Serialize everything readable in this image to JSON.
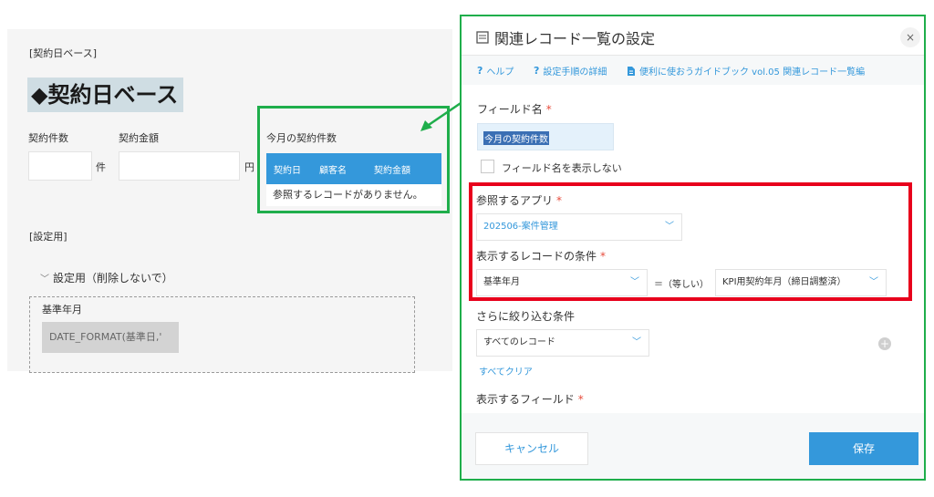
{
  "form": {
    "section_top_label": "[契約日ベース]",
    "title": "◆契約日ベース",
    "contract_count_label": "契約件数",
    "contract_amount_label": "契約金額",
    "unit_count": "件",
    "unit_yen": "円",
    "ref_table": {
      "label": "今月の契約件数",
      "columns": [
        "契約日",
        "顧客名",
        "契約金額"
      ],
      "empty_message": "参照するレコードがありません。"
    },
    "settings_section_label": "[設定用]",
    "settings_group_label": "設定用（削除しないで）",
    "base_month_label": "基準年月",
    "base_month_formula": "DATE_FORMAT(基準日,'"
  },
  "dialog": {
    "title": "関連レコード一覧の設定",
    "close": "×",
    "help_links": {
      "help": "ヘルプ",
      "steps": "設定手順の詳細",
      "guidebook": "便利に使おうガイドブック vol.05 関連レコード一覧編"
    },
    "field_name_label": "フィールド名",
    "field_name_value": "今月の契約件数",
    "hide_field_name_label": "フィールド名を表示しない",
    "ref_app_label": "参照するアプリ",
    "ref_app_value": "202506-案件管理",
    "condition_label": "表示するレコードの条件",
    "condition_left": "基準年月",
    "condition_operator": "＝（等しい）",
    "condition_right": "KPI用契約年月（締日調整済）",
    "filter_label": "さらに絞り込む条件",
    "filter_value": "すべてのレコード",
    "clear_all": "すべてクリア",
    "display_fields_label": "表示するフィールド",
    "cancel_label": "キャンセル",
    "save_label": "保存",
    "required_mark": "*"
  },
  "colors": {
    "accent": "#3498db",
    "highlight_green": "#1fae4b",
    "highlight_red": "#e8001c",
    "required": "#e74c3c"
  }
}
